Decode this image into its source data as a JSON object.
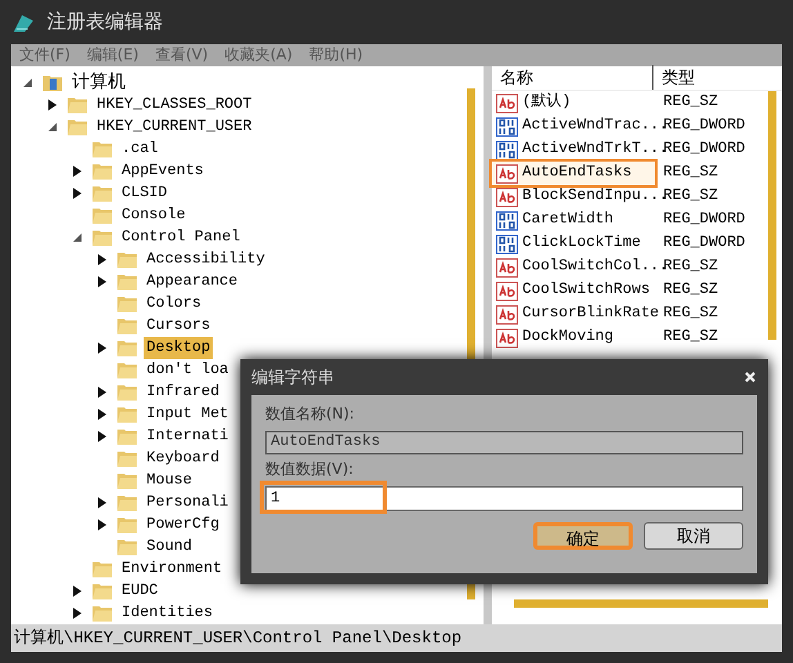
{
  "window": {
    "title": "注册表编辑器"
  },
  "menu": [
    "文件(F)",
    "编辑(E)",
    "查看(V)",
    "收藏夹(A)",
    "帮助(H)"
  ],
  "tree": [
    {
      "label": "计算机",
      "kind": "computer",
      "expanded": true,
      "selected": false,
      "children": [
        {
          "label": "HKEY_CLASSES_ROOT",
          "expanded": false,
          "selected": false
        },
        {
          "label": "HKEY_CURRENT_USER",
          "expanded": true,
          "selected": false,
          "children": [
            {
              "label": ".cal",
              "selected": false
            },
            {
              "label": "AppEvents",
              "expanded": false,
              "selected": false
            },
            {
              "label": "CLSID",
              "expanded": false,
              "selected": false
            },
            {
              "label": "Console",
              "selected": false
            },
            {
              "label": "Control Panel",
              "expanded": true,
              "selected": false,
              "children": [
                {
                  "label": "Accessibility",
                  "expanded": false,
                  "selected": false
                },
                {
                  "label": "Appearance",
                  "expanded": false,
                  "selected": false
                },
                {
                  "label": "Colors",
                  "selected": false
                },
                {
                  "label": "Cursors",
                  "selected": false
                },
                {
                  "label": "Desktop",
                  "expanded": false,
                  "selected": true
                },
                {
                  "label": "don't loa",
                  "selected": false
                },
                {
                  "label": "Infrared",
                  "expanded": false,
                  "selected": false
                },
                {
                  "label": "Input Met",
                  "expanded": false,
                  "selected": false
                },
                {
                  "label": "Internati",
                  "expanded": false,
                  "selected": false
                },
                {
                  "label": "Keyboard",
                  "selected": false
                },
                {
                  "label": "Mouse",
                  "selected": false
                },
                {
                  "label": "Personali",
                  "expanded": false,
                  "selected": false
                },
                {
                  "label": "PowerCfg",
                  "expanded": false,
                  "selected": false
                },
                {
                  "label": "Sound",
                  "selected": false
                }
              ]
            },
            {
              "label": "Environment",
              "selected": false
            },
            {
              "label": "EUDC",
              "expanded": false,
              "selected": false
            },
            {
              "label": "Identities",
              "expanded": false,
              "selected": false
            }
          ]
        }
      ]
    }
  ],
  "values": {
    "columns": [
      "名称",
      "类型"
    ],
    "rows": [
      {
        "kind": "string",
        "name": "(默认)",
        "type": "REG_SZ",
        "selected": false
      },
      {
        "kind": "dword",
        "name": "ActiveWndTrac...",
        "type": "REG_DWORD",
        "selected": false
      },
      {
        "kind": "dword",
        "name": "ActiveWndTrkT...",
        "type": "REG_DWORD",
        "selected": false
      },
      {
        "kind": "string",
        "name": "AutoEndTasks",
        "type": "REG_SZ",
        "selected": true
      },
      {
        "kind": "string",
        "name": "BlockSendInpu...",
        "type": "REG_SZ",
        "selected": false
      },
      {
        "kind": "dword",
        "name": "CaretWidth",
        "type": "REG_DWORD",
        "selected": false
      },
      {
        "kind": "dword",
        "name": "ClickLockTime",
        "type": "REG_DWORD",
        "selected": false
      },
      {
        "kind": "string",
        "name": "CoolSwitchCol...",
        "type": "REG_SZ",
        "selected": false
      },
      {
        "kind": "string",
        "name": "CoolSwitchRows",
        "type": "REG_SZ",
        "selected": false
      },
      {
        "kind": "string",
        "name": "CursorBlinkRate",
        "type": "REG_SZ",
        "selected": false
      },
      {
        "kind": "string",
        "name": "DockMoving",
        "type": "REG_SZ",
        "selected": false
      }
    ]
  },
  "dialog": {
    "title": "编辑字符串",
    "name_label": "数值名称(N):",
    "name_value": "AutoEndTasks",
    "data_label": "数值数据(V):",
    "data_value": "1",
    "data_highlighted": true,
    "buttons": [
      {
        "label": "确定",
        "highlighted": true
      },
      {
        "label": "取消",
        "highlighted": false
      }
    ]
  },
  "status_bar": "计算机\\HKEY_CURRENT_USER\\Control Panel\\Desktop"
}
